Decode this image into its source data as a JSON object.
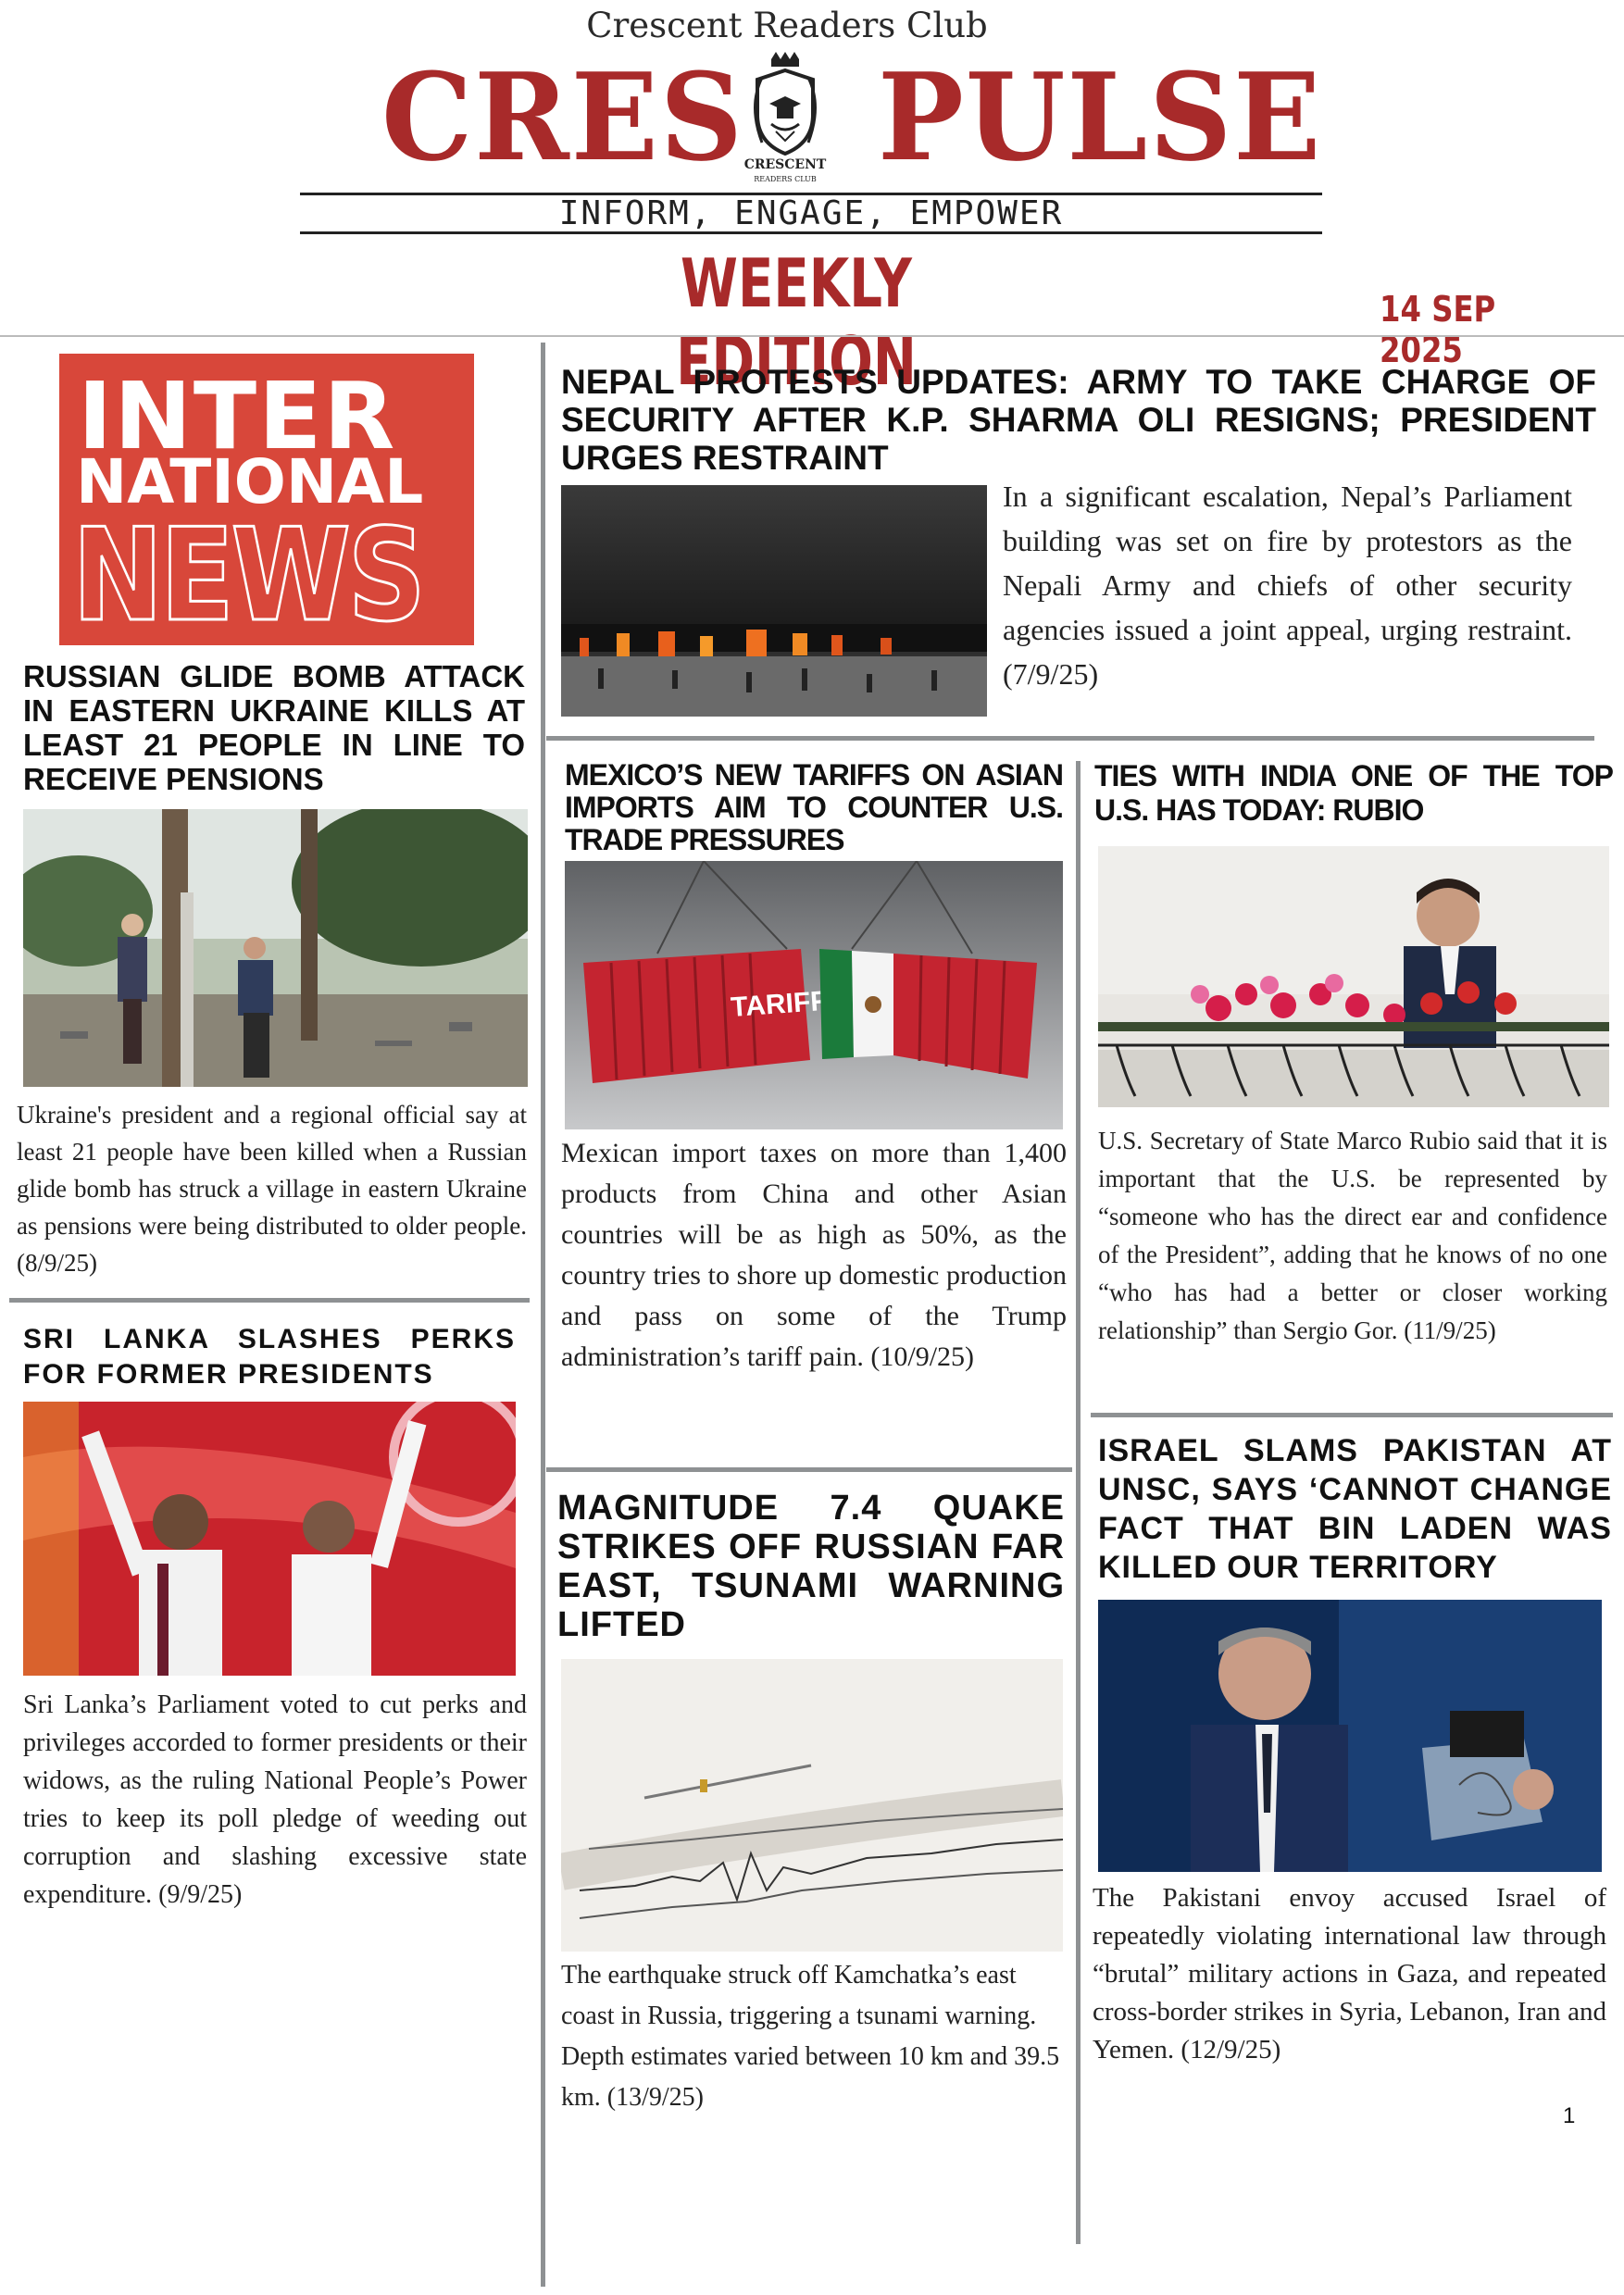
{
  "masthead": {
    "club_name": "Crescent Readers Club",
    "title_left": "CRES",
    "title_right": "PULSE",
    "crest_text_1": "CRESCENT",
    "crest_text_2": "READERS CLUB",
    "tagline": "INFORM, ENGAGE, EMPOWER",
    "edition": "WEEKLY EDITION",
    "date": "14 SEP 2025"
  },
  "section_badge": {
    "line1": "INTER",
    "line2": "NATIONAL",
    "line3": "NEWS"
  },
  "articles": {
    "nepal": {
      "headline": "NEPAL PROTESTS UPDATES: ARMY TO TAKE CHARGE OF SECURITY AFTER K.P. SHARMA OLI RESIGNS; PRESIDENT URGES RESTRAINT",
      "body": "In a significant escalation, Nepal’s Parliament building was set on fire by protestors as the Nepali Army and chiefs of other security agencies issued a joint appeal, urging restraint. (7/9/25)"
    },
    "ukraine": {
      "headline": "RUSSIAN GLIDE BOMB ATTACK IN EASTERN UKRAINE KILLS AT LEAST 21 PEOPLE IN LINE TO RECEIVE PENSIONS",
      "body": "Ukraine's president and a regional official say at least 21 people have been killed when a Russian glide bomb has struck a village in eastern Ukraine as pensions were being distributed to older people. (8/9/25)"
    },
    "srilanka": {
      "headline": "SRI LANKA SLASHES PERKS FOR FORMER PRESIDENTS",
      "body": "Sri Lanka’s Parliament voted to cut perks and privileges accorded to former presidents or their widows, as the ruling National People’s Power tries to keep its poll pledge of weeding out corruption and slashing excessive state expenditure. (9/9/25)"
    },
    "mexico": {
      "headline": "MEXICO’S NEW TARIFFS ON ASIAN IMPORTS AIM TO COUNTER U.S. TRADE PRESSURES",
      "image_label": "TARIFF",
      "body": "Mexican import taxes on more than 1,400 products from China and other Asian countries will be as high as 50%, as the country tries to shore up domestic production and pass on some of the Trump administration’s tariff pain. (10/9/25)"
    },
    "india": {
      "headline": "TIES WITH INDIA ONE OF THE TOP U.S. HAS TODAY: RUBIO",
      "body": "U.S. Secretary of State Marco Rubio said that it is important that the U.S. be represented by “someone who has the direct ear and confidence of the President”, adding that he knows of no one “who has had a better or closer working relationship” than Sergio Gor. (11/9/25)"
    },
    "israel": {
      "headline": "ISRAEL SLAMS PAKISTAN AT UNSC, SAYS ‘CANNOT CHANGE FACT THAT BIN LADEN WAS KILLED OUR TERRITORY",
      "body": "The Pakistani envoy accused Israel of repeatedly violating international law through “brutal” military actions in Gaza, and repeated cross-border strikes in Syria, Lebanon, Iran and Yemen. (12/9/25)"
    },
    "quake": {
      "headline": "MAGNITUDE 7.4 QUAKE STRIKES OFF RUSSIAN FAR EAST, TSUNAMI WARNING LIFTED",
      "body": "The earthquake struck off Kamchatka’s east coast in Russia, triggering a tsunami warning. Depth estimates varied between 10 km and 39.5 km. (13/9/25)"
    }
  },
  "page_number": "1"
}
